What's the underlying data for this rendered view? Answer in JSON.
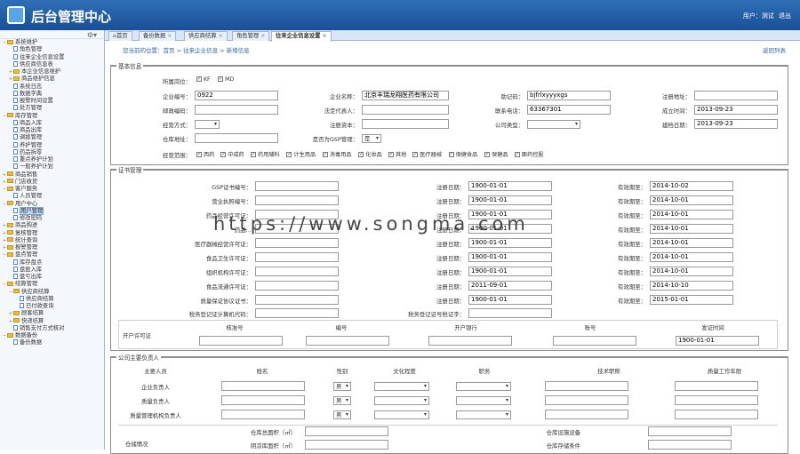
{
  "header": {
    "title": "后台管理中心",
    "user_label": "用户：",
    "user_name": "测试",
    "logout": "退出"
  },
  "sidebar": {
    "items": [
      {
        "label": "系统维护",
        "type": "folder",
        "level": 1,
        "toggle": "−"
      },
      {
        "label": "角色管理",
        "type": "page",
        "level": 2
      },
      {
        "label": "往来企业信息设置",
        "type": "page",
        "level": 2
      },
      {
        "label": "供应商信息表",
        "type": "page",
        "level": 2
      },
      {
        "label": "本企业信息维护",
        "type": "folder",
        "level": 2,
        "toggle": "+"
      },
      {
        "label": "商品维护信息",
        "type": "folder",
        "level": 2,
        "toggle": "+"
      },
      {
        "label": "系统日志",
        "type": "page",
        "level": 2
      },
      {
        "label": "数据字典",
        "type": "page",
        "level": 2
      },
      {
        "label": "报警时间设置",
        "type": "page",
        "level": 2
      },
      {
        "label": "处方管理",
        "type": "page",
        "level": 2
      },
      {
        "label": "库存管理",
        "type": "folder",
        "level": 1,
        "toggle": "−"
      },
      {
        "label": "商品入库",
        "type": "page",
        "level": 2
      },
      {
        "label": "商品出库",
        "type": "page",
        "level": 2
      },
      {
        "label": "调拨管理",
        "type": "page",
        "level": 2
      },
      {
        "label": "养护管理",
        "type": "page",
        "level": 2
      },
      {
        "label": "药品拆零",
        "type": "page",
        "level": 2
      },
      {
        "label": "重点养护计划",
        "type": "page",
        "level": 2
      },
      {
        "label": "一般养护计划",
        "type": "page",
        "level": 2
      },
      {
        "label": "商品销售",
        "type": "folder",
        "level": 1,
        "toggle": "+"
      },
      {
        "label": "门店收货",
        "type": "folder",
        "level": 1,
        "toggle": "+"
      },
      {
        "label": "客户服务",
        "type": "folder",
        "level": 1,
        "toggle": "−"
      },
      {
        "label": "人员管理",
        "type": "page",
        "level": 2
      },
      {
        "label": "用户中心",
        "type": "folder",
        "level": 1,
        "toggle": "−"
      },
      {
        "label": "用户管理",
        "type": "page",
        "level": 2,
        "selected": true
      },
      {
        "label": "修改密码",
        "type": "page",
        "level": 2
      },
      {
        "label": "商品购进",
        "type": "folder",
        "level": 1,
        "toggle": "+"
      },
      {
        "label": "复核管理",
        "type": "folder",
        "level": 1,
        "toggle": "+"
      },
      {
        "label": "统计查询",
        "type": "folder",
        "level": 1,
        "toggle": "+"
      },
      {
        "label": "报警管理",
        "type": "folder",
        "level": 1,
        "toggle": "+"
      },
      {
        "label": "盘点管理",
        "type": "folder",
        "level": 1,
        "toggle": "−"
      },
      {
        "label": "库存盘点",
        "type": "page",
        "level": 2
      },
      {
        "label": "盘盈入库",
        "type": "page",
        "level": 2
      },
      {
        "label": "盘亏出库",
        "type": "page",
        "level": 2
      },
      {
        "label": "结算管理",
        "type": "folder",
        "level": 1,
        "toggle": "−"
      },
      {
        "label": "供应商结算",
        "type": "folder",
        "level": 2,
        "toggle": "−"
      },
      {
        "label": "供应商结算",
        "type": "page",
        "level": 3
      },
      {
        "label": "已付款查询",
        "type": "page",
        "level": 3
      },
      {
        "label": "顾客结算",
        "type": "folder",
        "level": 2,
        "toggle": "+"
      },
      {
        "label": "快递结算",
        "type": "folder",
        "level": 2,
        "toggle": "+"
      },
      {
        "label": "销售支付方式核对",
        "type": "page",
        "level": 2
      },
      {
        "label": "数据备份",
        "type": "folder",
        "level": 1,
        "toggle": "−"
      },
      {
        "label": "备份数据",
        "type": "page",
        "level": 2
      }
    ]
  },
  "tabs": [
    {
      "label": "首页"
    },
    {
      "label": "备份数据"
    },
    {
      "label": "供应商结算"
    },
    {
      "label": "角色管理"
    },
    {
      "label": "往来企业信息设置",
      "active": true
    }
  ],
  "breadcrumb": {
    "text": "您当前的位置：首页 > 往来企业信息 > 新增信息"
  },
  "back_link": "返回列表",
  "basic": {
    "title": "基本信息",
    "position_label": "所属岗位：",
    "positions": [
      "KF",
      "MD"
    ],
    "company_code_label": "企业编号：",
    "company_code": "0922",
    "company_name_label": "企业名称：",
    "company_name": "北京丰瑞龙翔医药有限公司",
    "mnemonic_label": "助记码：",
    "mnemonic": "bjfrlxyyyxgs",
    "reg_address_label": "注册地址：",
    "reg_address": "",
    "postcode_label": "邮政编码：",
    "postcode": "",
    "legal_rep_label": "法定代表人：",
    "legal_rep": "",
    "phone_label": "联系电话：",
    "phone": "63367301",
    "established_label": "成立时间：",
    "established": "2013-09-23",
    "biz_mode_label": "经营方式：",
    "reg_capital_label": "注册资本：",
    "reg_capital": "",
    "company_type_label": "公司类型：",
    "created_label": "建档日期：",
    "created": "2013-09-23",
    "warehouse_addr_label": "仓库地址：",
    "warehouse_addr": "",
    "gsp_label": "是否为GSP管理：",
    "gsp": "是",
    "scope_label": "经营范围：",
    "scopes": [
      "西药",
      "中成药",
      "药用辅料",
      "计生用品",
      "消毒用品",
      "化妆品",
      "其他",
      "医疗器械",
      "保健食品",
      "保健品",
      "面药控股"
    ]
  },
  "cert": {
    "title": "证书管理",
    "rows": [
      {
        "name": "GSP证书编号：",
        "reg": "1900-01-01",
        "valid": "2014-10-02"
      },
      {
        "name": "营业执照编号：",
        "reg": "1900-01-01",
        "valid": "2014-10-01"
      },
      {
        "name": "药品经营许可证：",
        "reg": "1900-01-01",
        "valid": "2014-10-01"
      },
      {
        "name": "药品…",
        "reg": "1900-01-01",
        "valid": "2014-10-01"
      },
      {
        "name": "医疗器械经营许可证：",
        "reg": "1900-01-01",
        "valid": "2014-10-01"
      },
      {
        "name": "食品卫生许可证：",
        "reg": "1900-01-01",
        "valid": "2014-10-01"
      },
      {
        "name": "组织机构许可证：",
        "reg": "1900-01-01",
        "valid": "2014-10-01"
      },
      {
        "name": "食品流通许可证：",
        "reg": "2011-09-01",
        "valid": "2014-10-10"
      },
      {
        "name": "质量保证协议证书：",
        "reg": "1900-01-01",
        "valid": "2015-01-01"
      }
    ],
    "reg_label": "注册日期：",
    "valid_label": "有效期至：",
    "tax_label": "税务登记证计算机代码：",
    "tax_cert_label": "税务登记证号税证字：",
    "bank_label": "开户许可证",
    "bank_headers": [
      "核准号",
      "编号",
      "开户银行",
      "账号",
      "发证时间"
    ],
    "bank_date": "1900-01-01"
  },
  "staff": {
    "title": "公司主要负责人",
    "headers": [
      "主要人员",
      "姓名",
      "性别",
      "文化程度",
      "职务",
      "技术职称",
      "质量工作年限"
    ],
    "rows": [
      {
        "role": "企业负责人",
        "gender": "男"
      },
      {
        "role": "质量负责人",
        "gender": "男"
      },
      {
        "role": "质量管理机构负责人",
        "gender": "男"
      }
    ],
    "warehouse_label": "仓储情况",
    "wh_area_label": "仓库总面积（㎡）",
    "cold_area_label": "阴凉库面积（㎡）",
    "wh_equip_label": "仓库设施设备",
    "wh_cond_label": "仓库存储条件"
  },
  "watermark": "https://www.songma.com"
}
